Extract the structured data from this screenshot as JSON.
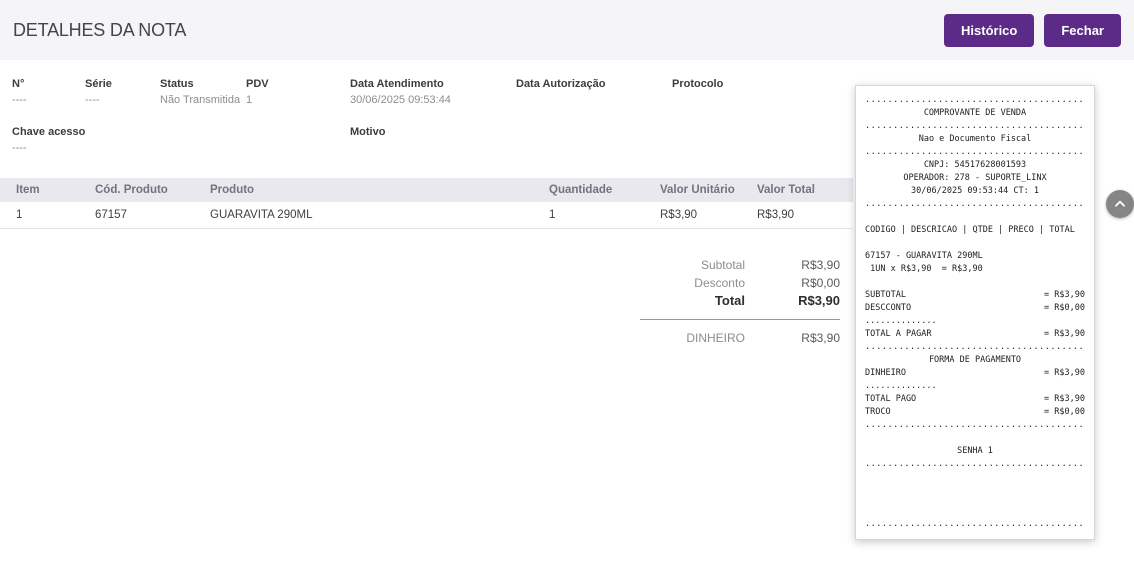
{
  "header": {
    "title": "DETALHES DA NOTA",
    "history_button": "Histórico",
    "close_button": "Fechar"
  },
  "colors": {
    "accent_purple": "#5b2b87",
    "topbar_bg": "#f5f4f6",
    "table_header_bg": "#e9e8ee"
  },
  "details": {
    "fields_row1": [
      {
        "label": "N°",
        "value": "----"
      },
      {
        "label": "Série",
        "value": "----"
      },
      {
        "label": "Status",
        "value": "Não Transmitida"
      },
      {
        "label": "PDV",
        "value": "1"
      },
      {
        "label": "Data Atendimento",
        "value": "30/06/2025 09:53:44"
      },
      {
        "label": "Data Autorização",
        "value": ""
      },
      {
        "label": "Protocolo",
        "value": ""
      }
    ],
    "fields_row2": [
      {
        "label": "Chave acesso",
        "value": "----"
      },
      {
        "label": "Motivo",
        "value": ""
      }
    ]
  },
  "table": {
    "columns": [
      "Item",
      "Cód. Produto",
      "Produto",
      "Quantidade",
      "Valor Unitário",
      "Valor Total"
    ],
    "rows": [
      [
        "1",
        "67157",
        "GUARAVITA 290ML",
        "1",
        "R$3,90",
        "R$3,90"
      ]
    ]
  },
  "summary": {
    "rows": [
      {
        "label": "Subtotal",
        "value": "R$3,90"
      },
      {
        "label": "Desconto",
        "value": "R$0,00"
      },
      {
        "label": "Total",
        "value": "R$3,90"
      }
    ],
    "payment": {
      "label": "DINHEIRO",
      "value": "R$3,90"
    }
  },
  "receipt": {
    "lines": [
      {
        "type": "divider"
      },
      {
        "type": "center",
        "text": "COMPROVANTE DE VENDA"
      },
      {
        "type": "divider"
      },
      {
        "type": "center",
        "text": "Nao e Documento Fiscal"
      },
      {
        "type": "divider"
      },
      {
        "type": "center",
        "text": "CNPJ: 54517628001593"
      },
      {
        "type": "center",
        "text": "OPERADOR: 278 - SUPORTE_LINX"
      },
      {
        "type": "center",
        "text": "30/06/2025 09:53:44 CT: 1"
      },
      {
        "type": "divider"
      },
      {
        "type": "blank"
      },
      {
        "type": "left",
        "text": "CODIGO | DESCRICAO | QTDE | PRECO | TOTAL"
      },
      {
        "type": "blank"
      },
      {
        "type": "left",
        "text": "67157 - GUARAVITA 290ML"
      },
      {
        "type": "left",
        "text": " 1UN x R$3,90  = R$3,90"
      },
      {
        "type": "blank"
      },
      {
        "type": "pair",
        "l": "SUBTOTAL",
        "r": "= R$3,90"
      },
      {
        "type": "pair",
        "l": "DESCCONTO",
        "r": "= R$0,00"
      },
      {
        "type": "short-divider"
      },
      {
        "type": "pair",
        "l": "TOTAL A PAGAR",
        "r": "= R$3,90"
      },
      {
        "type": "divider"
      },
      {
        "type": "center",
        "text": "FORMA DE PAGAMENTO"
      },
      {
        "type": "pair",
        "l": "DINHEIRO",
        "r": "= R$3,90"
      },
      {
        "type": "short-divider"
      },
      {
        "type": "pair",
        "l": "TOTAL PAGO",
        "r": "= R$3,90"
      },
      {
        "type": "pair",
        "l": "TROCO",
        "r": "= R$0,00"
      },
      {
        "type": "divider"
      },
      {
        "type": "blank"
      },
      {
        "type": "center",
        "text": "SENHA 1"
      },
      {
        "type": "divider"
      },
      {
        "type": "divider"
      }
    ]
  }
}
